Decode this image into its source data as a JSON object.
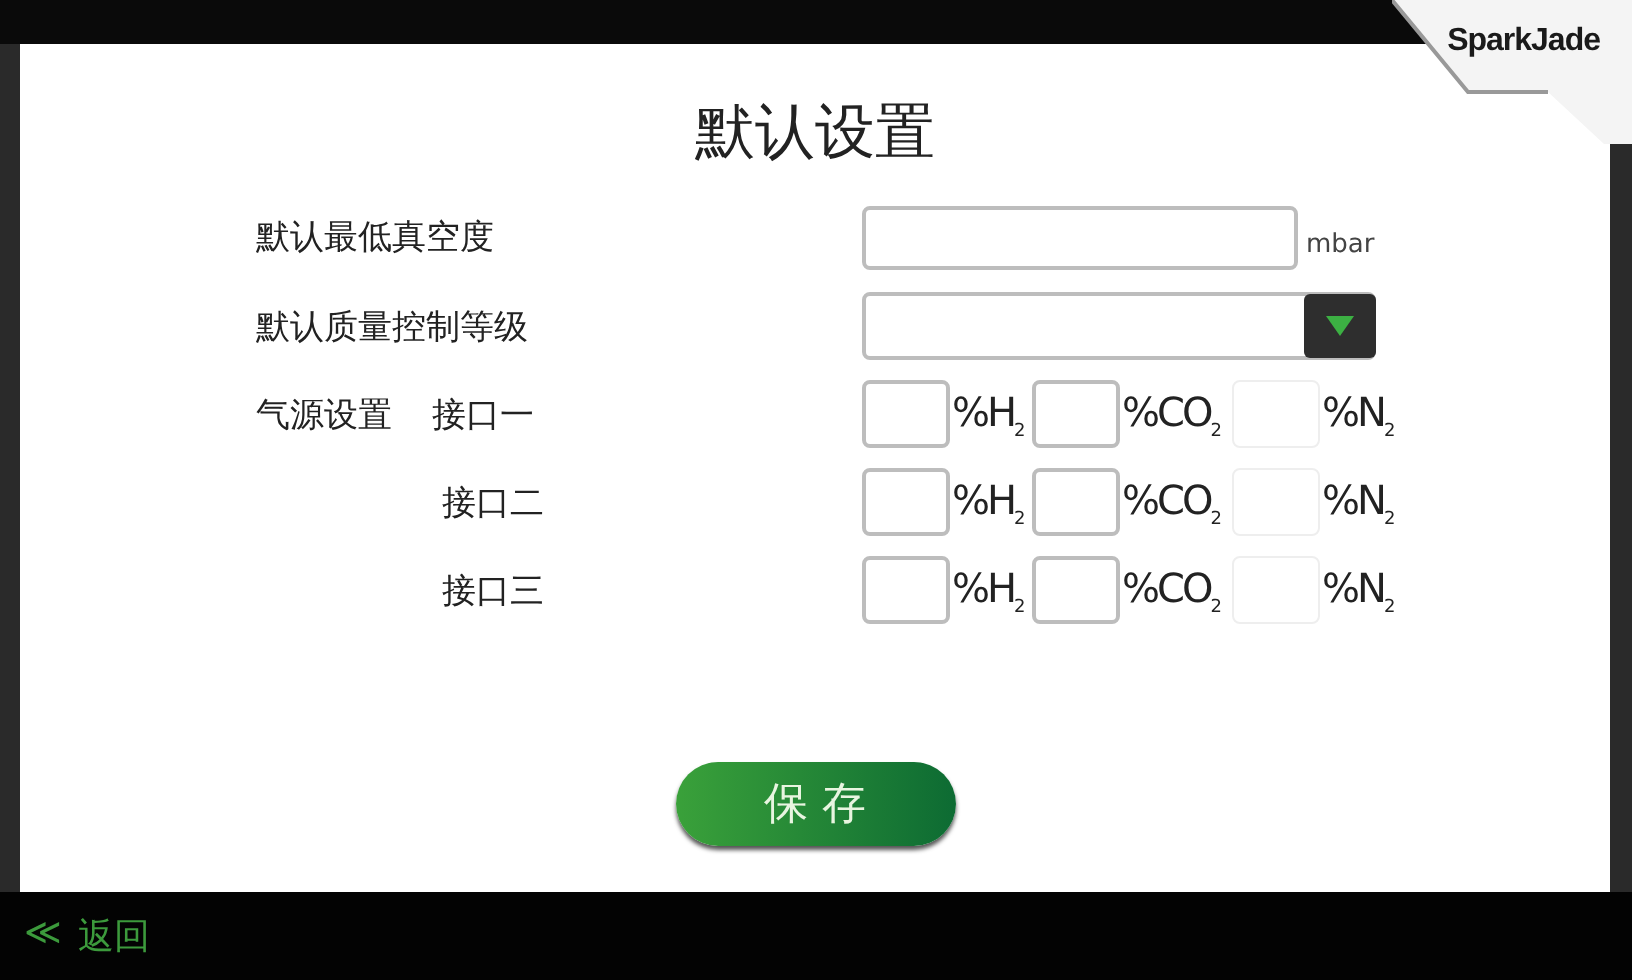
{
  "logo": {
    "text": "SparkJade"
  },
  "title": "默认设置",
  "fields": [
    {
      "kind": "text",
      "label": "默认最低真空度",
      "unit": "mbar"
    },
    {
      "kind": "select",
      "label": "默认质量控制等级"
    }
  ],
  "gas_source": {
    "label": "气源设置",
    "ports": [
      {
        "label": "接口一",
        "inputs": [
          {
            "unit": "%H$_{2}$",
            "disabled": false
          },
          {
            "unit": "%CO$_{2}$",
            "disabled": false
          },
          {
            "unit": "%N$_{2}$",
            "disabled": true
          }
        ]
      },
      {
        "label": "接口二",
        "inputs": [
          {
            "unit": "%H$_{2}$",
            "disabled": false
          },
          {
            "unit": "%CO$_{2}$",
            "disabled": false
          },
          {
            "unit": "%N$_{2}$",
            "disabled": true
          }
        ]
      },
      {
        "label": "接口三",
        "inputs": [
          {
            "unit": "%H$_{2}$",
            "disabled": false
          },
          {
            "unit": "%CO$_{2}$",
            "disabled": false
          },
          {
            "unit": "%N$_{2}$",
            "disabled": true
          }
        ]
      }
    ]
  },
  "save_button": "保 存",
  "back": {
    "icon": "≪",
    "label": "返回"
  }
}
